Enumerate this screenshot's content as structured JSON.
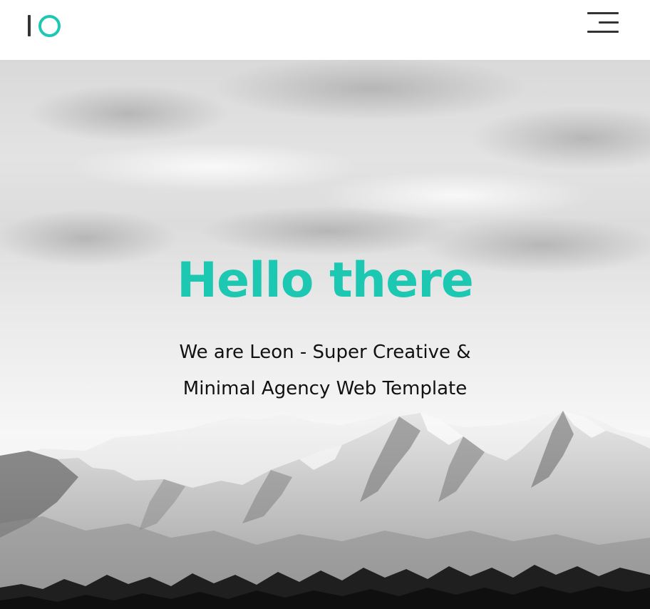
{
  "header": {
    "logo_icon": "io-logo-icon",
    "menu_icon": "hamburger-menu-icon"
  },
  "hero": {
    "title": "Hello there",
    "subtitle_line1": "We are Leon - Super Creative &",
    "subtitle_line2": "Minimal Agency Web Template",
    "background": "mountain-landscape-image"
  },
  "colors": {
    "accent": "#1dc8b3",
    "dark": "#333333",
    "text": "#111111",
    "header_bg": "#ffffff"
  }
}
